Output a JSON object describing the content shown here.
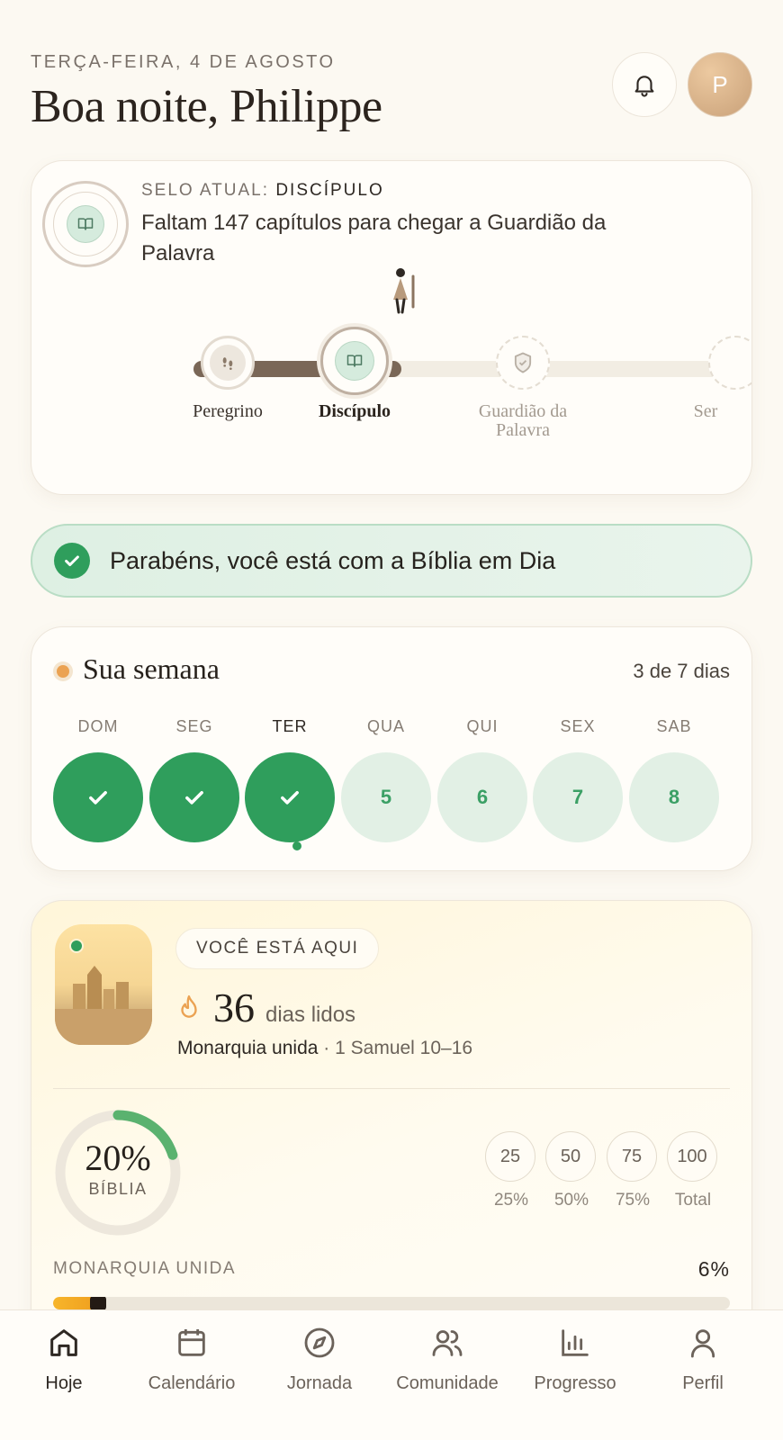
{
  "header": {
    "date": "TERÇA-FEIRA, 4 DE AGOSTO",
    "greeting": "Boa noite, Philippe",
    "avatar_initial": "P",
    "bell_icon": "bell-icon"
  },
  "seal": {
    "label_prefix": "SELO ATUAL:",
    "current": "DISCÍPULO",
    "description": "Faltam 147 capítulos para chegar a Guardião da Palavra",
    "milestones": [
      {
        "label": "Peregrino",
        "state": "done",
        "icon": "footprints-icon"
      },
      {
        "label": "Discípulo",
        "state": "current",
        "icon": "book-icon"
      },
      {
        "label": "Guardião da Palavra",
        "state": "locked",
        "icon": "shield-icon"
      },
      {
        "label": "Ser",
        "state": "locked",
        "icon": "locked-icon"
      }
    ]
  },
  "congrats": {
    "text": "Parabéns, você está com a Bíblia em Dia"
  },
  "week": {
    "title": "Sua semana",
    "count": "3 de 7 dias",
    "days": [
      {
        "label": "DOM",
        "value": "",
        "done": true
      },
      {
        "label": "SEG",
        "value": "",
        "done": true
      },
      {
        "label": "TER",
        "value": "",
        "done": true,
        "today": true
      },
      {
        "label": "QUA",
        "value": "5",
        "done": false
      },
      {
        "label": "QUI",
        "value": "6",
        "done": false
      },
      {
        "label": "SEX",
        "value": "7",
        "done": false
      },
      {
        "label": "SAB",
        "value": "8",
        "done": false
      }
    ]
  },
  "journey": {
    "pill": "VOCÊ ESTÁ AQUI",
    "days_read": "36",
    "days_unit": "dias lidos",
    "period": "Monarquia unida",
    "passage": "· 1 Samuel 10–16",
    "bible_percent": "20%",
    "bible_progress": 0.2,
    "bible_label": "BÍBLIA",
    "milestones": [
      {
        "value": "25",
        "label": "25%"
      },
      {
        "value": "50",
        "label": "50%"
      },
      {
        "value": "75",
        "label": "75%"
      },
      {
        "value": "100",
        "label": "Total"
      }
    ],
    "era_label": "MONARQUIA UNIDA",
    "era_percent": "6%",
    "era_progress": 0.06
  },
  "nav": [
    {
      "label": "Hoje",
      "icon": "home-icon",
      "active": true
    },
    {
      "label": "Calendário",
      "icon": "calendar-icon",
      "active": false
    },
    {
      "label": "Jornada",
      "icon": "compass-icon",
      "active": false
    },
    {
      "label": "Comunidade",
      "icon": "users-icon",
      "active": false
    },
    {
      "label": "Progresso",
      "icon": "bar-chart-icon",
      "active": false
    },
    {
      "label": "Perfil",
      "icon": "user-icon",
      "active": false
    }
  ],
  "colors": {
    "background": "#fcf9f2",
    "accent_green": "#2f9e5c",
    "light_green": "#e2f0e5",
    "streak_orange": "#eba252",
    "track_brown": "#7a6757"
  }
}
